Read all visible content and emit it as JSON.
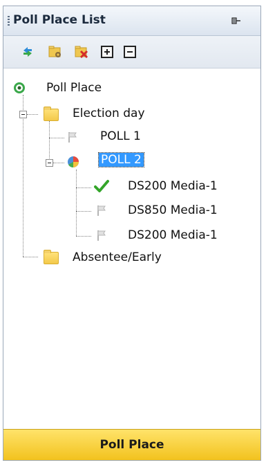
{
  "panel": {
    "title": "Poll Place List",
    "pin_icon": "pin-icon"
  },
  "toolbar": {
    "buttons": [
      {
        "name": "refresh",
        "icon": "refresh-icon"
      },
      {
        "name": "folder-tools",
        "icon": "folder-gear-icon"
      },
      {
        "name": "folder-delete",
        "icon": "folder-delete-icon"
      },
      {
        "name": "expand-all",
        "icon": "plus-box-icon"
      },
      {
        "name": "collapse-all",
        "icon": "minus-box-icon"
      }
    ]
  },
  "tree": {
    "root": {
      "label": "Poll Place",
      "icon": "target-icon"
    },
    "election_day": {
      "label": "Election day"
    },
    "poll1": {
      "label": "POLL 1"
    },
    "poll2": {
      "label": "POLL 2",
      "selected": true
    },
    "media": [
      {
        "label": "DS200 Media-1",
        "icon": "check-icon"
      },
      {
        "label": "DS850 Media-1",
        "icon": "flag-icon"
      },
      {
        "label": "DS200 Media-1",
        "icon": "flag-icon"
      }
    ],
    "absentee": {
      "label": "Absentee/Early"
    }
  },
  "footer": {
    "label": "Poll Place"
  },
  "colors": {
    "selection": "#3399ff",
    "footer": "#f6cf3a",
    "check": "#34a52a"
  }
}
